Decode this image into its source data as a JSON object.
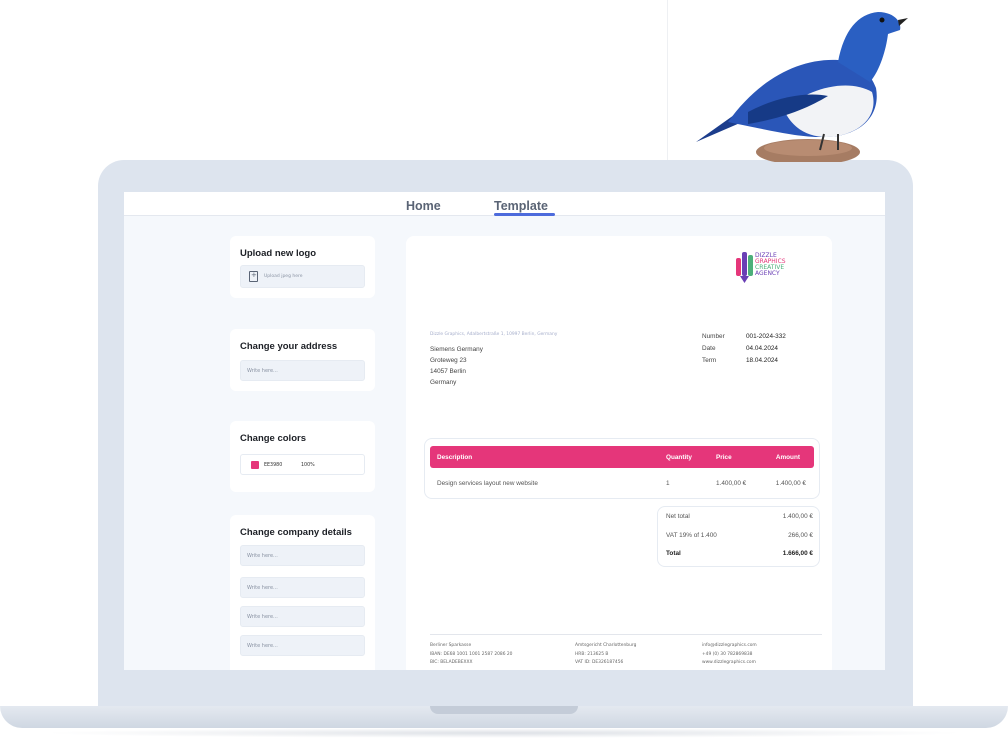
{
  "nav": {
    "home": "Home",
    "template": "Template"
  },
  "panels": {
    "logo": {
      "title": "Upload new logo",
      "upload_text": "Upload jpeg here"
    },
    "address": {
      "title": "Change your address",
      "placeholder": "Write here..."
    },
    "colors": {
      "title": "Change colors",
      "hex": "EE3980",
      "opacity": "100%",
      "swatch_color": "#e5367a"
    },
    "company": {
      "title": "Change company details",
      "placeholders": [
        "Write here...",
        "Write here...",
        "Write here...",
        "Write here..."
      ]
    }
  },
  "invoice": {
    "logo_lines": [
      "DIZZLE",
      "GRAPHICS",
      "CREATIVE",
      "AGENCY"
    ],
    "sender_line": "Dizzle Graphics, Adalbertstraße 1, 10997 Berlin, Germany",
    "recipient": [
      "Siemens Germany",
      "Groteweg 23",
      "14057 Berlin",
      "Germany"
    ],
    "meta": [
      {
        "label": "Number",
        "value": "001-2024-332"
      },
      {
        "label": "Date",
        "value": "04.04.2024"
      },
      {
        "label": "Term",
        "value": "18.04.2024"
      }
    ],
    "table": {
      "headers": {
        "description": "Description",
        "quantity": "Quantity",
        "price": "Price",
        "amount": "Amount"
      },
      "rows": [
        {
          "description": "Design services layout new website",
          "quantity": "1",
          "price": "1.400,00 €",
          "amount": "1.400,00 €"
        }
      ]
    },
    "totals": [
      {
        "label": "Net total",
        "value": "1.400,00 €"
      },
      {
        "label": "VAT 19% of 1.400",
        "value": "266,00 €"
      },
      {
        "label": "Total",
        "value": "1.666,00 €"
      }
    ],
    "footer": [
      [
        "Berliner Sparkasse",
        "IBAN: DE68 1001 1001 2587 2086 20",
        "BIC: BELADEBEXXX"
      ],
      [
        "Amtsgericht Charlottenburg",
        "HRB: 213625 B",
        "VAT ID: DE326187456"
      ],
      [
        "info@dizzlegraphics.com",
        "+49 (0) 30 782869838",
        "www.dizzlegraphics.com"
      ]
    ],
    "accent_color": "#e5367a"
  }
}
